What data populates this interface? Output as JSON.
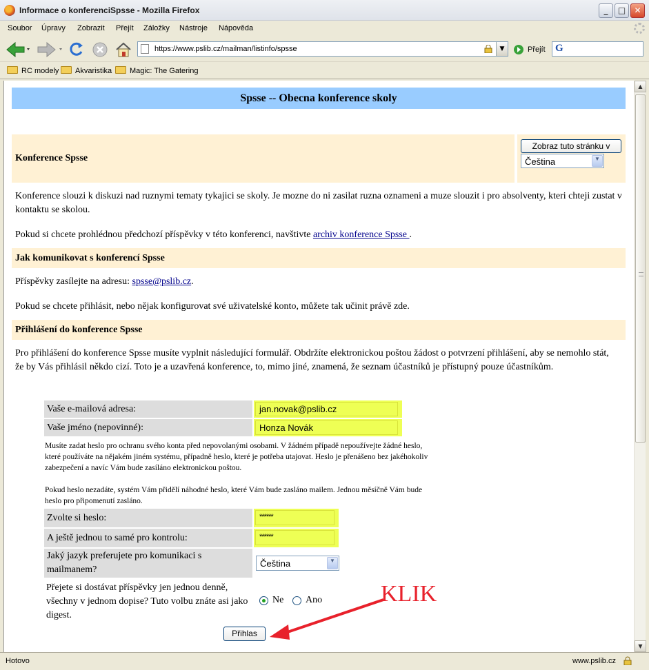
{
  "window": {
    "title": "Informace o konferenciSpsse - Mozilla Firefox"
  },
  "menu": [
    "Soubor",
    "Úpravy",
    "Zobrazit",
    "Přejít",
    "Záložky",
    "Nástroje",
    "Nápověda"
  ],
  "nav": {
    "url": "https://www.pslib.cz/mailman/listinfo/spsse",
    "go_label": "Přejít",
    "search_logo": "G"
  },
  "bookmarks": [
    "RC modely",
    "Akvaristika",
    "Magic: The Gatering"
  ],
  "page": {
    "header_title": "Spsse -- Obecna konference skoly",
    "list_title": "Konference Spsse",
    "view_button": "Zobraz tuto stránku v",
    "language_select": "Čeština",
    "description": "Konference slouzi k diskuzi nad ruznymi tematy tykajici se skoly. Je mozne do ni zasilat ruzna oznameni a muze slouzit i pro absolventy, kteri chteji zustat v kontaktu se skolou.",
    "archive_prefix": "Pokud si chcete prohlédnou předchozí příspěvky v této konferenci, navštivte ",
    "archive_link": "archiv konference Spsse ",
    "archive_suffix": ".",
    "section_comm": "Jak komunikovat s konferencí Spsse",
    "post_prefix": "Příspěvky zasílejte na adresu: ",
    "post_email": "spsse@pslib.cz",
    "post_suffix": ".",
    "subscribe_hint": "Pokud se chcete přihlásit, nebo nějak konfigurovat své uživatelské konto, můžete tak učinit právě zde.",
    "section_sub": "Přihlášení do konference Spsse",
    "sub_intro": "Pro přihlášení do konference Spsse musíte vyplnit následující formulář. Obdržíte elektronickou poštou žádost o potvrzení přihlášení, aby se nemohlo stát, že by Vás přihlásil někdo cizí. Toto je a uzavřená konference, to, mimo jiné, znamená, že seznam účastníků je přístupný pouze účastníkům."
  },
  "form": {
    "email_label": "Vaše e-mailová adresa:",
    "email_value": "jan.novak@pslib.cz",
    "name_label": "Vaše jméno (nepovinné):",
    "name_value": "Honza Novák",
    "pw_note1": "Musíte zadat heslo pro ochranu svého konta před nepovolanými osobami. V žádném případě nepoužívejte žádné heslo, které používáte na nějakém jiném systému, případně heslo, které je potřeba utajovat. Heslo je přenášeno bez jakéhokoliv zabezpečení a navíc Vám bude zasíláno elektronickou poštou.",
    "pw_note2": "Pokud heslo nezadáte, systém Vám přidělí náhodné heslo, které Vám bude zasláno mailem. Jednou měsíčně Vám bude heslo pro připomenutí zasláno.",
    "pw_label": "Zvolte si heslo:",
    "pw_value": "******",
    "pw2_label": "A ještě jednou to samé pro kontrolu:",
    "pw2_value": "******",
    "lang_label": "Jaký jazyk preferujete pro komunikaci s mailmanem?",
    "lang_value": "Čeština",
    "digest_label": "Přejete si dostávat příspěvky jen jednou denně, všechny v jednom dopise? Tuto volbu znáte asi jako digest.",
    "digest_no": "Ne",
    "digest_yes": "Ano",
    "digest_selected": "Ne",
    "submit": "Přihlas"
  },
  "annotation": {
    "text": "KLIK",
    "color": "#e8212b"
  },
  "status": {
    "left": "Hotovo",
    "right": "www.pslib.cz"
  },
  "colors": {
    "header_bg": "#99ccff",
    "band_bg": "#fff1d4",
    "input_bg": "#eeff55",
    "label_bg": "#dddddd"
  }
}
